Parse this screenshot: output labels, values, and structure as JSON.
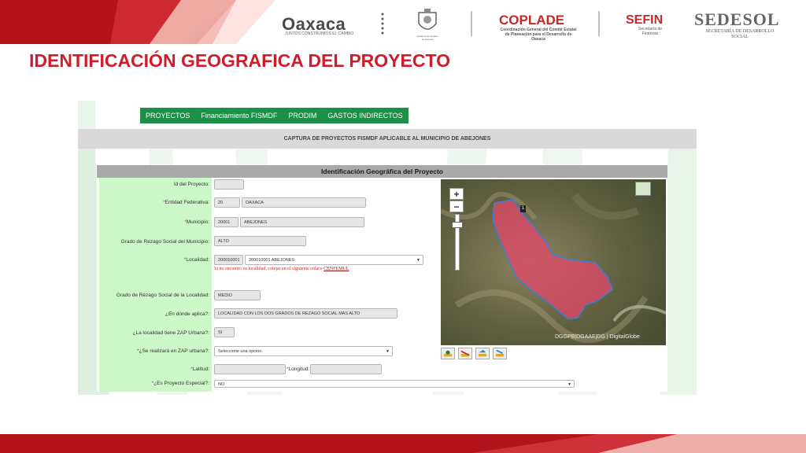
{
  "slide": {
    "title": "IDENTIFICACIÓN GEOGRAFICA DEL PROYECTO"
  },
  "header_logos": {
    "oaxaca": "Oaxaca",
    "oaxaca_tagline": "JUNTOS CONSTRUIMOS EL CAMBIO",
    "gov_seal_text": "Gobierno del Estado de Oaxaca",
    "coplade": "COPLADE",
    "coplade_sub": "Coordinación General del Comité Estatal de Planeación para el Desarrollo de Oaxaca",
    "sefin": "SEFIN",
    "sefin_sub": "Secretaría de Finanzas",
    "sedesol": "SEDESOL",
    "sedesol_sub": "SECRETARÍA DE DESARROLLO SOCIAL"
  },
  "nav": {
    "items": [
      {
        "label": "PROYECTOS"
      },
      {
        "label": "Financiamiento FISMDF"
      },
      {
        "label": "PRODIM"
      },
      {
        "label": "GASTOS INDIRECTOS"
      }
    ]
  },
  "capture_title": "CAPTURA DE PROYECTOS FISMDF APLICABLE AL MUNICIPIO DE ABEJONES",
  "card": {
    "header": "Identificación Geográfica del Proyecto"
  },
  "form": {
    "req_mark": "*",
    "id_label": "Id del Proyecto:",
    "id_value": "",
    "entidad_label": "Entidad Federativa:",
    "entidad_code": "20",
    "entidad_name": "OAXACA",
    "municipio_label": "Municipio:",
    "municipio_code": "20001",
    "municipio_name": "ABEJONES",
    "rezago_mun_label": "Grado de Rezago Social del Municipio:",
    "rezago_mun_value": "ALTO",
    "localidad_label": "Localidad:",
    "localidad_code": "200010001",
    "localidad_select": "200010001 ABEJONES",
    "localidad_msg": "Si no encontro su localidad, cotejar en el siguiente enlace",
    "localidad_link": "CENFEMUL",
    "rezago_loc_label": "Grado de Rezago Social de la Localidad:",
    "rezago_loc_value": "MEDIO",
    "aplica_label": "¿En dónde aplica?:",
    "aplica_value": "LOCALIDAD CON LOS DOS GRADOS DE REZAGO SOCIAL MAS ALTO",
    "zap_label": "¿La localidad tiene ZAP Urbana?:",
    "zap_value": "SI",
    "zap_realiza_label": "¿Se realizará en ZAP urbana?:",
    "zap_realiza_value": "Seleccione una opcion.",
    "latitud_label": "Latitud:",
    "latitud_value": "",
    "longitud_label": "Longitud:",
    "longitud_value": "",
    "especial_label": "¿Es Proyecto Especial?:",
    "especial_value": "NO"
  },
  "map": {
    "zoom_in": "+",
    "zoom_out": "−",
    "marker": "1",
    "attribution": "DGGPB|DGAAE|DG | DigitalGlobe"
  },
  "colors": {
    "brand_red": "#d01c2a",
    "nav_green": "#1e8f49",
    "form_green": "#ccf7c9"
  }
}
